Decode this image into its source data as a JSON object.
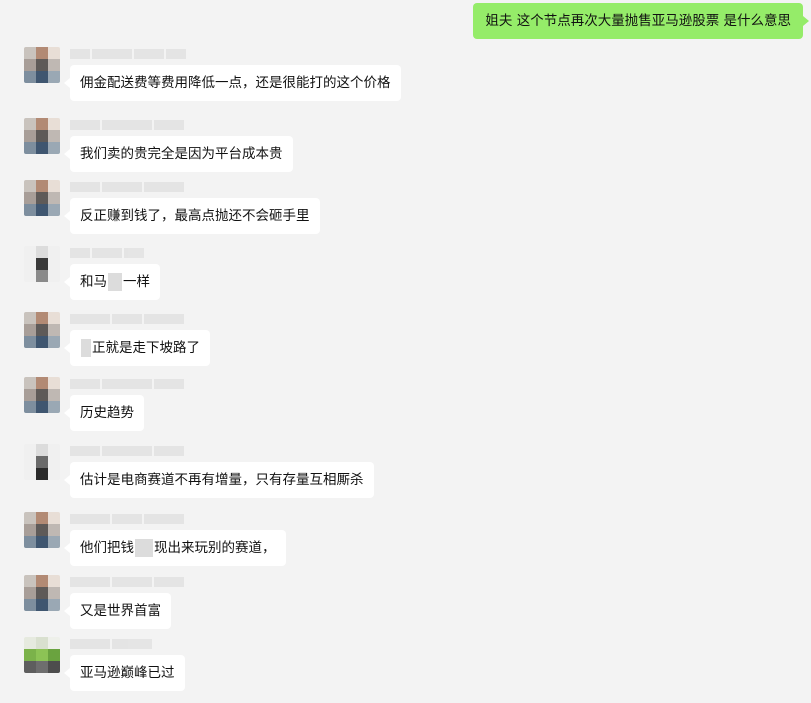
{
  "outgoing": {
    "text": "姐夫  这个节点再次大量抛售亚马逊股票  是什么意思",
    "color": "#95ec69"
  },
  "messages": [
    {
      "text": "佣金配送费等费用降低一点，还是很能打的这个价格"
    },
    {
      "text": "我们卖的贵完全是因为平台成本贵"
    },
    {
      "text": "反正赚到钱了，最高点抛还不会砸手里"
    },
    {
      "text_a": "和马",
      "text_b": "一样"
    },
    {
      "text_a": "",
      "text_b": "正就是走下坡路了"
    },
    {
      "text": "历史趋势"
    },
    {
      "text": "估计是电商赛道不再有增量，只有存量互相厮杀"
    },
    {
      "text_a": "他们把钱",
      "text_b": "现出来玩别的赛道，"
    },
    {
      "text": "又是世界首富"
    },
    {
      "text": "亚马逊巅峰已过"
    }
  ]
}
